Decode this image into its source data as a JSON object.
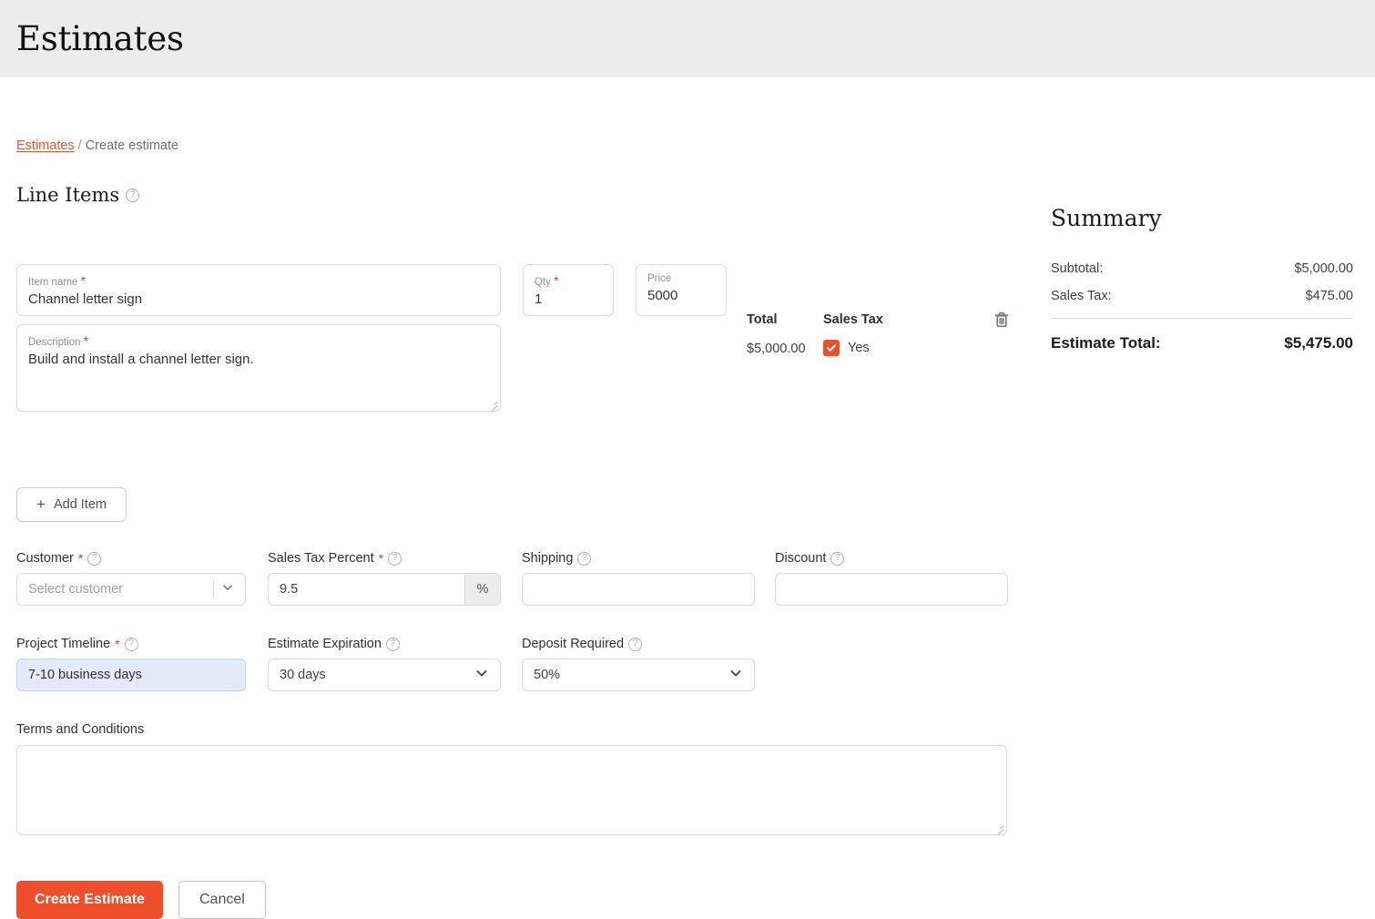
{
  "header": {
    "title": "Estimates"
  },
  "breadcrumb": {
    "root": "Estimates",
    "separator": "/",
    "current": "Create estimate"
  },
  "line_items_section": {
    "title": "Line Items",
    "columns": {
      "total": "Total",
      "sales_tax": "Sales Tax"
    },
    "items": [
      {
        "item_name_label": "Item name",
        "item_name_value": "Channel letter sign",
        "description_label": "Description",
        "description_value": "Build and install a channel letter sign.",
        "qty_label": "Qty",
        "qty_value": "1",
        "price_label": "Price",
        "price_value": "5000",
        "total_value": "$5,000.00",
        "sales_tax_value": "Yes",
        "sales_tax_checked": true
      }
    ],
    "add_item_label": "Add Item",
    "add_item_glyph": "+"
  },
  "form": {
    "customer": {
      "label": "Customer",
      "required": true,
      "value": "",
      "placeholder": "Select customer"
    },
    "sales_tax_percent": {
      "label": "Sales Tax Percent",
      "required": true,
      "value": "9.5",
      "suffix": "%"
    },
    "shipping": {
      "label": "Shipping",
      "required": false,
      "value": ""
    },
    "discount": {
      "label": "Discount",
      "required": false,
      "value": ""
    },
    "project_timeline": {
      "label": "Project Timeline",
      "required": true,
      "value": "7-10 business days"
    },
    "estimate_expiration": {
      "label": "Estimate Expiration",
      "required": false,
      "value": "30 days"
    },
    "deposit_required": {
      "label": "Deposit Required",
      "required": false,
      "value": "50%"
    },
    "terms": {
      "label": "Terms and Conditions",
      "value": ""
    }
  },
  "actions": {
    "submit_label": "Create Estimate",
    "cancel_label": "Cancel"
  },
  "summary": {
    "title": "Summary",
    "rows": [
      {
        "label": "Subtotal:",
        "value": "$5,000.00"
      },
      {
        "label": "Sales Tax:",
        "value": "$475.00"
      }
    ],
    "total_label": "Estimate Total:",
    "total_value": "$5,475.00"
  },
  "icons": {
    "help": "?",
    "required_mark": "*"
  },
  "colors": {
    "accent": "#ef4e2b",
    "link": "#e8552f",
    "header_bg": "#ececec",
    "autofill_bg": "#e3ebfa",
    "border": "#d6dade"
  }
}
